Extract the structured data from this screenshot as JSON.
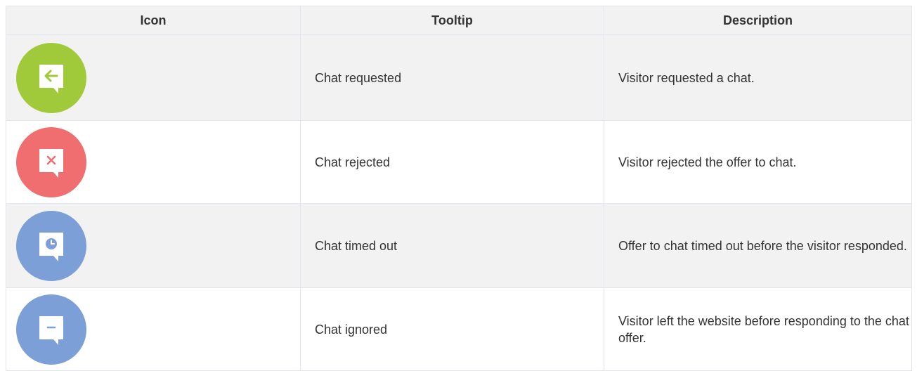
{
  "table": {
    "headers": {
      "icon": "Icon",
      "tooltip": "Tooltip",
      "description": "Description"
    },
    "rows": [
      {
        "icon": "chat-requested-icon",
        "icon_color": "#a0ca3a",
        "tooltip": "Chat requested",
        "description": "Visitor requested a chat."
      },
      {
        "icon": "chat-rejected-icon",
        "icon_color": "#f06e70",
        "tooltip": "Chat rejected",
        "description": "Visitor rejected the offer to chat."
      },
      {
        "icon": "chat-timed-out-icon",
        "icon_color": "#7b9fd6",
        "tooltip": "Chat timed out",
        "description": "Offer to chat timed out before the visitor responded."
      },
      {
        "icon": "chat-ignored-icon",
        "icon_color": "#7b9fd6",
        "tooltip": "Chat ignored",
        "description": "Visitor left the website before responding to the chat offer."
      }
    ]
  },
  "colors": {
    "header_bg": "#f2f2f2",
    "row_shade_bg": "#f2f2f2",
    "border": "#e2e5ee",
    "text": "#333333"
  }
}
